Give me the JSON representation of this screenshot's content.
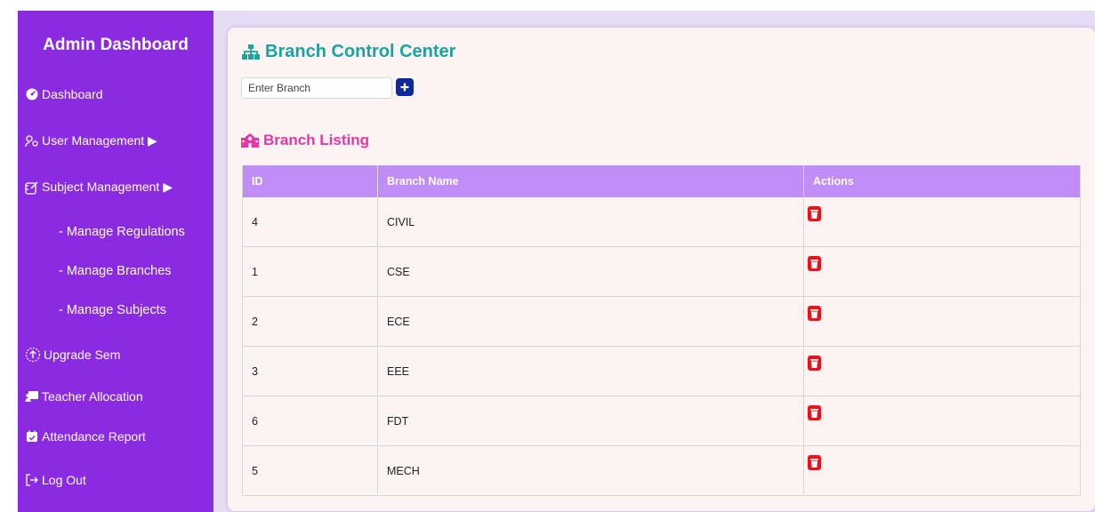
{
  "sidebar": {
    "title": "Admin Dashboard",
    "items": [
      {
        "label": "Dashboard",
        "icon": "dashboard-gauge-icon"
      },
      {
        "label": "User Management ▶",
        "icon": "users-icon"
      },
      {
        "label": "Subject Management ▶",
        "icon": "subject-edit-icon"
      },
      {
        "label": "Upgrade Sem",
        "icon": "upgrade-arrow-icon"
      },
      {
        "label": "Teacher Allocation",
        "icon": "teacher-board-icon"
      },
      {
        "label": "Attendance Report",
        "icon": "calendar-check-icon"
      },
      {
        "label": "Log Out",
        "icon": "logout-icon"
      }
    ],
    "subitems": [
      {
        "label": "- Manage Regulations"
      },
      {
        "label": "- Manage Branches"
      },
      {
        "label": "- Manage Subjects"
      }
    ]
  },
  "main": {
    "title": "Branch Control Center",
    "input_placeholder": "Enter Branch",
    "add_icon": "plus-icon",
    "listing_title": "Branch Listing",
    "table": {
      "headers": [
        "ID",
        "Branch Name",
        "Actions"
      ],
      "rows": [
        {
          "id": "4",
          "name": "CIVIL"
        },
        {
          "id": "1",
          "name": "CSE"
        },
        {
          "id": "2",
          "name": "ECE"
        },
        {
          "id": "3",
          "name": "EEE"
        },
        {
          "id": "6",
          "name": "FDT"
        },
        {
          "id": "5",
          "name": "MECH"
        }
      ],
      "delete_icon": "trash-icon"
    }
  },
  "colors": {
    "sidebar": "#8a2be2",
    "title": "#1aa3a3",
    "listing_title": "#e636a8",
    "table_header": "#c08cf6",
    "add_button": "#0e2a9a",
    "delete": "#e8131b"
  }
}
